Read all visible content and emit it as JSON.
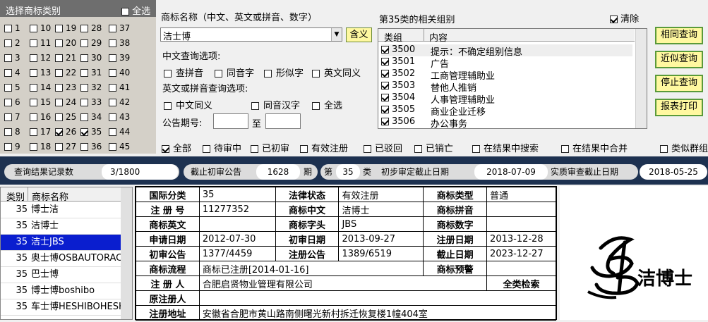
{
  "category_panel": {
    "title": "选择商标类别",
    "select_all": "全选",
    "cells": [
      {
        "n": "1",
        "on": false
      },
      {
        "n": "10",
        "on": false
      },
      {
        "n": "19",
        "on": false
      },
      {
        "n": "28",
        "on": false
      },
      {
        "n": "37",
        "on": false
      },
      {
        "n": "2",
        "on": false
      },
      {
        "n": "11",
        "on": false
      },
      {
        "n": "20",
        "on": false
      },
      {
        "n": "29",
        "on": false
      },
      {
        "n": "38",
        "on": false
      },
      {
        "n": "3",
        "on": false
      },
      {
        "n": "12",
        "on": false
      },
      {
        "n": "21",
        "on": false
      },
      {
        "n": "30",
        "on": false
      },
      {
        "n": "39",
        "on": false
      },
      {
        "n": "4",
        "on": false
      },
      {
        "n": "13",
        "on": false
      },
      {
        "n": "22",
        "on": false
      },
      {
        "n": "31",
        "on": false
      },
      {
        "n": "40",
        "on": false
      },
      {
        "n": "5",
        "on": false
      },
      {
        "n": "14",
        "on": false
      },
      {
        "n": "23",
        "on": false
      },
      {
        "n": "32",
        "on": false
      },
      {
        "n": "41",
        "on": false
      },
      {
        "n": "6",
        "on": false
      },
      {
        "n": "15",
        "on": false
      },
      {
        "n": "24",
        "on": false
      },
      {
        "n": "33",
        "on": false
      },
      {
        "n": "42",
        "on": false
      },
      {
        "n": "7",
        "on": false
      },
      {
        "n": "16",
        "on": false
      },
      {
        "n": "25",
        "on": false
      },
      {
        "n": "34",
        "on": false
      },
      {
        "n": "43",
        "on": false
      },
      {
        "n": "8",
        "on": false
      },
      {
        "n": "17",
        "on": false
      },
      {
        "n": "26",
        "on": true
      },
      {
        "n": "35",
        "on": true
      },
      {
        "n": "44",
        "on": false
      },
      {
        "n": "9",
        "on": false
      },
      {
        "n": "18",
        "on": false
      },
      {
        "n": "27",
        "on": false
      },
      {
        "n": "36",
        "on": false
      },
      {
        "n": "45",
        "on": false
      }
    ]
  },
  "query": {
    "name_label": "商标名称（中文、英文或拼音、数字）",
    "name_value": "洁士博",
    "contain_button": "含义",
    "cn_options_label": "中文查询选项:",
    "cn_options": [
      "查拼音",
      "同音字",
      "形似字",
      "英文同义"
    ],
    "en_options_label": "英文或拼音查询选项:",
    "en_options": [
      "中文同义",
      "同音汉字",
      "全选"
    ],
    "issue_label": "公告期号:",
    "issue_to": "至",
    "issue_from_value": "",
    "issue_to_value": ""
  },
  "group_panel": {
    "title": "第35类的相关组别",
    "clear_label": "清除",
    "col_group": "类组",
    "col_content": "内容",
    "rows": [
      {
        "code": "3500",
        "text": "提示：不确定组别信息"
      },
      {
        "code": "3501",
        "text": "广告"
      },
      {
        "code": "3502",
        "text": "工商管理辅助业"
      },
      {
        "code": "3503",
        "text": "替他人推销"
      },
      {
        "code": "3504",
        "text": "人事管理辅助业"
      },
      {
        "code": "3505",
        "text": "商业企业迁移"
      },
      {
        "code": "3506",
        "text": "办公事务"
      }
    ]
  },
  "actions": {
    "same": "相同查询",
    "similar": "近似查询",
    "stop": "停止查询",
    "report": "报表打印"
  },
  "filters": [
    {
      "label": "全部",
      "on": true
    },
    {
      "label": "待审中",
      "on": false
    },
    {
      "label": "已初审",
      "on": false
    },
    {
      "label": "有效注册",
      "on": false
    },
    {
      "label": "已驳回",
      "on": false
    },
    {
      "label": "已销亡",
      "on": false
    },
    {
      "label": "在结果中搜索",
      "on": false
    },
    {
      "label": "在结果中合并",
      "on": false
    },
    {
      "label": "类似群组",
      "on": false
    }
  ],
  "status": {
    "records_label": "查询结果记录数",
    "records_value": "3/1800",
    "deadline_label": "截止初审公告",
    "deadline_value": "1628",
    "deadline_unit": "期",
    "class_prefix": "第",
    "class_value": "35",
    "class_suffix": "类",
    "prelim_label": "初步审定截止日期",
    "prelim_value": "2018-07-09",
    "exam_label": "实质审查截止日期",
    "exam_value": "2018-05-25"
  },
  "results": {
    "col_class": "类别",
    "col_name": "商标名称",
    "rows": [
      {
        "cls": "35",
        "name": "博士洁",
        "sel": false
      },
      {
        "cls": "35",
        "name": "洁博士",
        "sel": false
      },
      {
        "cls": "35",
        "name": "洁士JBS",
        "sel": true
      },
      {
        "cls": "35",
        "name": "奥士博OSBAUTORACING",
        "sel": false
      },
      {
        "cls": "35",
        "name": "巴士博",
        "sel": false
      },
      {
        "cls": "35",
        "name": "博士博boshibo",
        "sel": false
      },
      {
        "cls": "35",
        "name": "车士博HESHIBOHESHIB",
        "sel": false
      }
    ]
  },
  "detail": {
    "intl_class_k": "国际分类",
    "intl_class_v": "35",
    "legal_status_k": "法律状态",
    "legal_status_v": "有效注册",
    "tm_type_k": "商标类型",
    "tm_type_v": "普通",
    "reg_no_k": "注 册 号",
    "reg_no_v": "11277352",
    "tm_cn_k": "商标中文",
    "tm_cn_v": "洁博士",
    "tm_pinyin_k": "商标拼音",
    "tm_pinyin_v": "",
    "tm_en_k": "商标英文",
    "tm_en_v": "",
    "tm_initial_k": "商标字头",
    "tm_initial_v": "JBS",
    "tm_digit_k": "商标数字",
    "tm_digit_v": "",
    "apply_date_k": "申请日期",
    "apply_date_v": "2012-07-30",
    "prelim_date_k": "初审日期",
    "prelim_date_v": "2013-09-27",
    "reg_date_k": "注册日期",
    "reg_date_v": "2013-12-28",
    "prelim_pub_k": "初审公告",
    "prelim_pub_v": "1377/4459",
    "reg_pub_k": "注册公告",
    "reg_pub_v": "1389/6519",
    "end_date_k": "截止日期",
    "end_date_v": "2023-12-27",
    "flow_k": "商标流程",
    "flow_v": "商标已注册[2014-01-16]",
    "warn_k": "商标预警",
    "warn_v": "",
    "registrant_k": "注 册 人",
    "registrant_v": "合肥启贤物业管理有限公司",
    "full_search": "全类检索",
    "orig_registrant_k": "原注册人",
    "orig_registrant_v": "",
    "address_k": "注册地址",
    "address_v": "安徽省合肥市黄山路南侧曙光新村拆迁恢复楼1幢404室"
  },
  "logo": {
    "text": "洁博士"
  }
}
